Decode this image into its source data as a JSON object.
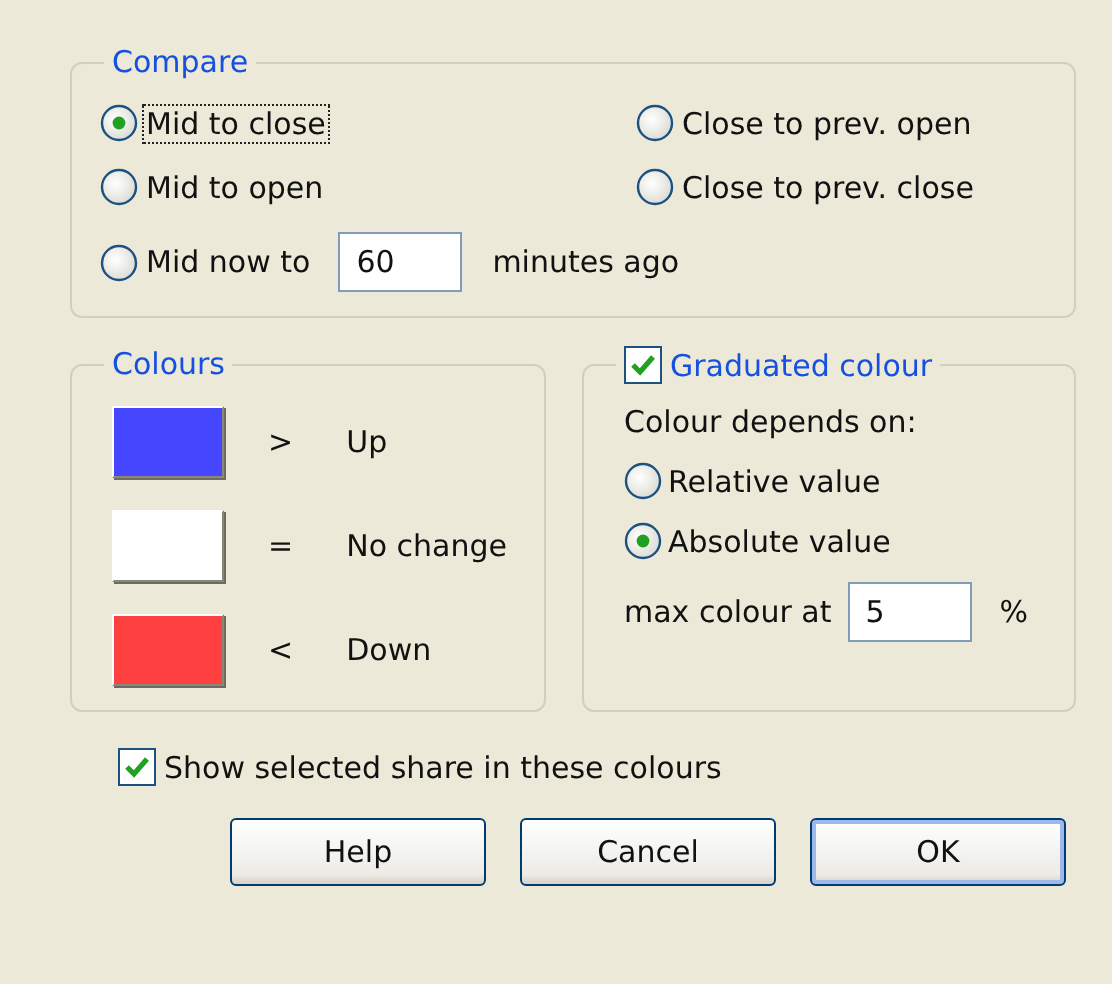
{
  "compare": {
    "title": "Compare",
    "options": [
      {
        "kind": "plain",
        "label": "Mid to close",
        "selected": true,
        "focused": true
      },
      {
        "kind": "plain",
        "label": "Close to prev. open",
        "selected": false,
        "focused": false
      },
      {
        "kind": "plain",
        "label": "Mid to open",
        "selected": false,
        "focused": false
      },
      {
        "kind": "plain",
        "label": "Close to prev. close",
        "selected": false,
        "focused": false
      },
      {
        "kind": "with_field",
        "label": "Mid now to",
        "selected": false,
        "focused": false,
        "value": "60",
        "suffix": "minutes ago"
      }
    ]
  },
  "colours": {
    "title": "Colours",
    "items": [
      {
        "symbol": ">",
        "label": "Up",
        "color": "#4646ff"
      },
      {
        "symbol": "=",
        "label": "No change",
        "color": "#ffffff"
      },
      {
        "symbol": "<",
        "label": "Down",
        "color": "#ff4040"
      }
    ]
  },
  "graduated": {
    "label": "Graduated colour",
    "checked": true,
    "depends_label": "Colour depends on:",
    "options": [
      {
        "label": "Relative value",
        "selected": false
      },
      {
        "label": "Absolute value",
        "selected": true
      }
    ],
    "max": {
      "label": "max colour at",
      "value": "5",
      "unit": "%"
    }
  },
  "show_selected": {
    "label": "Show selected share in these colours",
    "checked": true
  },
  "buttons": [
    {
      "label": "Help",
      "default": false
    },
    {
      "label": "Cancel",
      "default": false
    },
    {
      "label": "OK",
      "default": true
    }
  ]
}
